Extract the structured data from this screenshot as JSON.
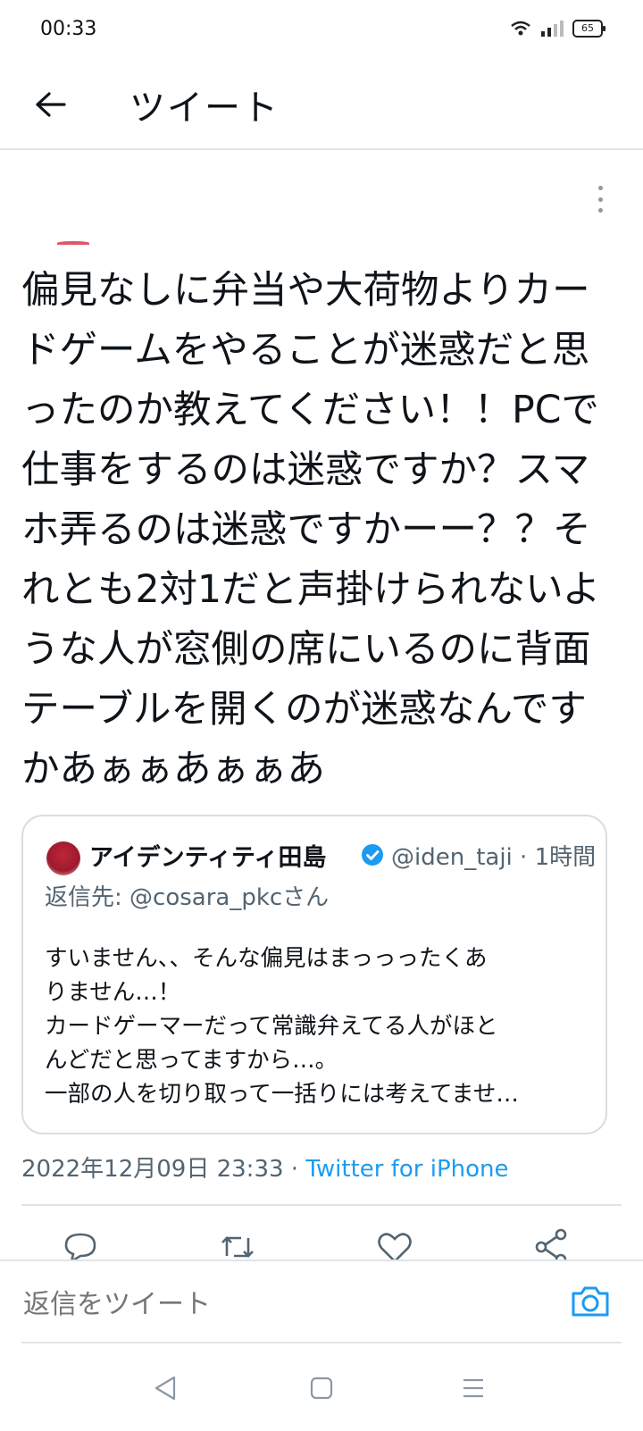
{
  "status_bar": {
    "time": "00:33",
    "battery": "65"
  },
  "header": {
    "title": "ツイート"
  },
  "tweet": {
    "lines": [
      "偏見なしに弁当や大荷物よりカー",
      "ドゲームをやることが迷惑だと思",
      "ったのか教えてください！！PCで",
      "仕事をするのは迷惑ですか？スマ",
      "ホ弄るのは迷惑ですかーー？？そ",
      "れとも2対1だと声掛けられないよ",
      "うな人が窓側の席にいるのに背面",
      "テーブルを開くのが迷惑なんです",
      "かあぁぁあぁぁあ"
    ],
    "timestamp": "2022年12月09日 23:33",
    "separator": "·",
    "source": "Twitter for iPhone"
  },
  "quoted": {
    "name": "アイデンティティ田島",
    "handle": "@iden_taji · 1時間",
    "replying_to": "返信先: @cosara_pkcさん",
    "lines": [
      "すいません、、そんな偏見はまっっったくあ",
      "りません…！",
      "カードゲーマーだって常識弁えてる人がほと",
      "んどだと思ってますから…。",
      "一部の人を切り取って一括りには考えてませ…"
    ]
  },
  "reply_box": {
    "placeholder": "返信をツイート"
  },
  "colors": {
    "accent": "#1d9bf0",
    "secondary_text": "#536471"
  }
}
